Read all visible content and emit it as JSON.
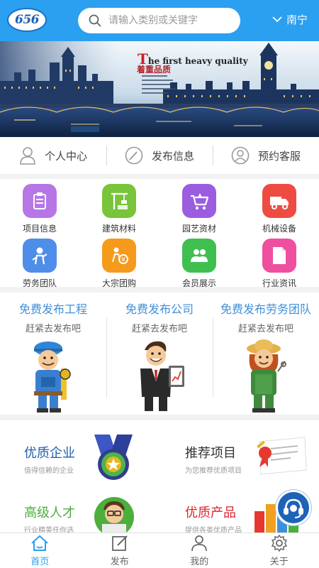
{
  "header": {
    "logo_text": "656",
    "search_placeholder": "请输入类别或关键字",
    "city": "南宁"
  },
  "banner": {
    "title_first": "T",
    "title_rest": "he first heavy quality",
    "subtitle": "着重品质"
  },
  "quick": [
    {
      "label": "个人中心",
      "icon": "person-icon"
    },
    {
      "label": "发布信息",
      "icon": "edit-icon"
    },
    {
      "label": "预约客服",
      "icon": "service-icon"
    }
  ],
  "categories": [
    {
      "label": "项目信息",
      "icon": "clipboard-icon",
      "color": "#b676e6"
    },
    {
      "label": "建筑材料",
      "icon": "crane-icon",
      "color": "#78c43a"
    },
    {
      "label": "园艺资材",
      "icon": "cart-icon",
      "color": "#9b5ce0"
    },
    {
      "label": "机械设备",
      "icon": "truck-icon",
      "color": "#ee4b43"
    },
    {
      "label": "劳务团队",
      "icon": "worker-icon",
      "color": "#4f8ee8"
    },
    {
      "label": "大宗团购",
      "icon": "group-buy-icon",
      "color": "#f59a1b"
    },
    {
      "label": "会员展示",
      "icon": "members-icon",
      "color": "#3fbf4f"
    },
    {
      "label": "行业资讯",
      "icon": "document-icon",
      "color": "#ef4fa0"
    }
  ],
  "promo": [
    {
      "title": "免费发布工程",
      "sub": "赶紧去发布吧"
    },
    {
      "title": "免费发布公司",
      "sub": "赶紧去发布吧"
    },
    {
      "title": "免费发布劳务团队",
      "sub": "赶紧去发布吧"
    }
  ],
  "recommend": [
    {
      "title": "优质企业",
      "sub": "值得信赖的企业",
      "color": "#1f5ea8"
    },
    {
      "title": "推荐项目",
      "sub": "为您推荐优质项目",
      "color": "#333333"
    },
    {
      "title": "高级人才",
      "sub": "行业精英任你选",
      "color": "#4cae3c"
    },
    {
      "title": "优质产品",
      "sub": "提供各类优质产品",
      "color": "#d8262f"
    }
  ],
  "tabs": [
    {
      "label": "首页",
      "icon": "home-icon",
      "active": true
    },
    {
      "label": "发布",
      "icon": "publish-icon",
      "active": false
    },
    {
      "label": "我的",
      "icon": "profile-icon",
      "active": false
    },
    {
      "label": "关于",
      "icon": "settings-icon",
      "active": false
    }
  ],
  "colors": {
    "accent": "#2b9ff0",
    "promo_title": "#3f8fd9"
  }
}
